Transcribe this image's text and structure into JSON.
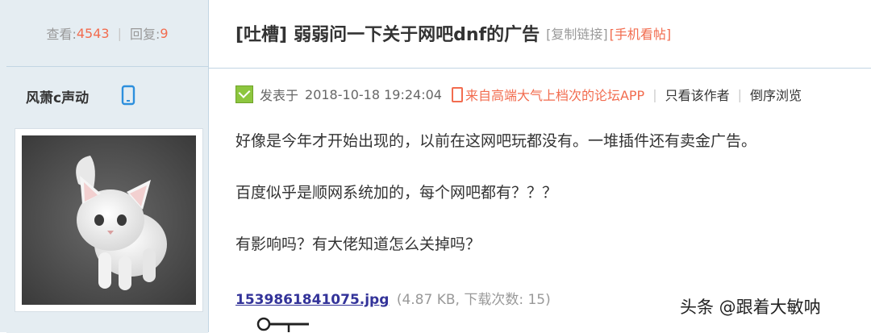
{
  "stats": {
    "views_label": "查看:",
    "views_count": "4543",
    "separator": "|",
    "replies_label": "回复:",
    "replies_count": "9"
  },
  "user": {
    "name": "风萧c声动",
    "device_icon": "phone-icon",
    "avatar": "white-kitten-photo"
  },
  "thread": {
    "tag": "[吐槽]",
    "title": "弱弱问一下关于网吧dnf的广告",
    "copy_link": "[复制链接]",
    "mobile_view": "[手机看帖]"
  },
  "post_meta": {
    "posted_prefix": "发表于",
    "date": "2018-10-18 19:24:04",
    "source": "来自高端大气上档次的论坛APP",
    "separator": "|",
    "only_author": "只看该作者",
    "reverse_order": "倒序浏览"
  },
  "content": {
    "lines": [
      "好像是今年才开始出现的，以前在这网吧玩都没有。一堆插件还有卖金广告。",
      "百度似乎是顺网系统加的，每个网吧都有？？？",
      "有影响吗？有大佬知道怎么关掉吗？"
    ]
  },
  "attachment": {
    "filename": "1539861841075.jpg",
    "meta": "(4.87 KB, 下载次数: 15)"
  },
  "watermark": "头条 @跟着大敏呐",
  "colors": {
    "sidebar_bg": "#e5edf2",
    "border": "#c2d5e3",
    "accent_orange": "#f26c4f",
    "link_blue": "#333399",
    "text": "#333333",
    "muted": "#999999"
  }
}
